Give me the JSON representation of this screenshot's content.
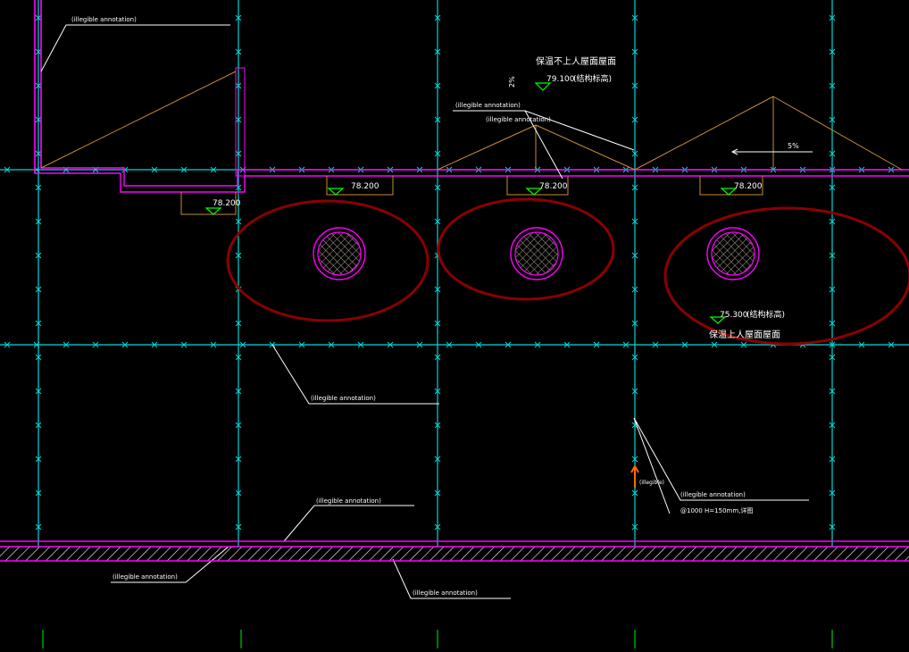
{
  "colors": {
    "background": "#000000",
    "grid": "#00d8d8",
    "wall": "#ff00ff",
    "slope": "#c88c3c",
    "leader": "#ffffff",
    "marker": "#00ff00",
    "highlight": "#8b0000",
    "text": "#ffffff",
    "accent": "#ff6a00"
  },
  "labels": {
    "roof_title": "保温不上人屋面屋面",
    "roof_elev": "79.100",
    "roof_elev_note": "(结构标高)",
    "slope_marker": "2%",
    "top_left_note": "(illegible annotation)",
    "upper_mid_note_1": "(illegible annotation)",
    "upper_mid_note_2": "(illegible annotation)",
    "gutter_elev_1": "78.200",
    "gutter_elev_2": "78.200",
    "gutter_elev_3": "78.200",
    "gutter_elev_4": "78.200",
    "lower_elev": "75.300",
    "lower_elev_note": "(结构标高)",
    "lower_roof_title": "保温上人屋面屋面",
    "arrow_slope": "5%",
    "mid_leader_note": "(illegible annotation)",
    "right_note_1": "(illegible annotation)",
    "right_note_2": "@1000 H=150mm,详图",
    "accent_marker": "(illegible)",
    "bottom_note_1": "(illegible annotation)",
    "bottom_note_2": "(illegible annotation)",
    "bottom_note_3": "(illegible annotation)"
  }
}
